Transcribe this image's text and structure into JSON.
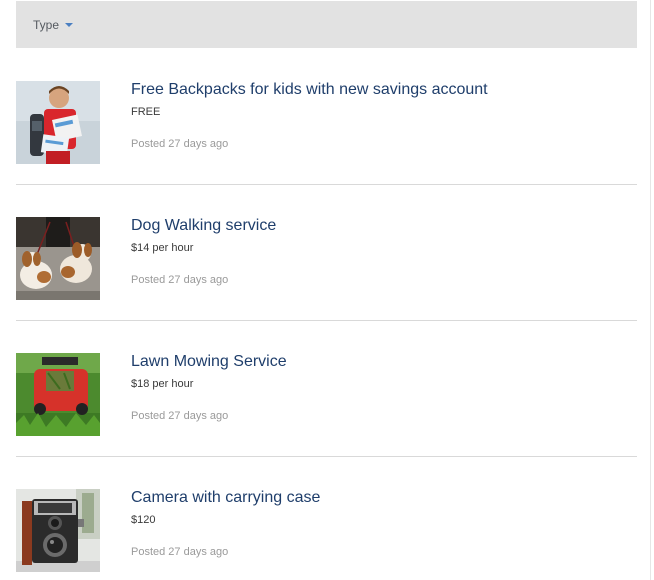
{
  "filter": {
    "type_label": "Type"
  },
  "listings": [
    {
      "title": "Free Backpacks for kids with new savings account",
      "price": "FREE",
      "posted": "Posted 27 days ago",
      "image": "child-with-backpack-photo"
    },
    {
      "title": "Dog Walking service",
      "price": "$14 per hour",
      "posted": "Posted 27 days ago",
      "image": "dogs-on-leash-photo"
    },
    {
      "title": "Lawn Mowing Service",
      "price": "$18 per hour",
      "posted": "Posted 27 days ago",
      "image": "red-lawn-mower-photo"
    },
    {
      "title": "Camera with carrying case",
      "price": "$120",
      "posted": "Posted 27 days ago",
      "image": "vintage-camera-photo"
    }
  ],
  "colors": {
    "title": "#1f3e6b",
    "filter_bar_bg": "#e2e2e2",
    "caret": "#4a7fc1",
    "posted": "#9a9a9a"
  }
}
